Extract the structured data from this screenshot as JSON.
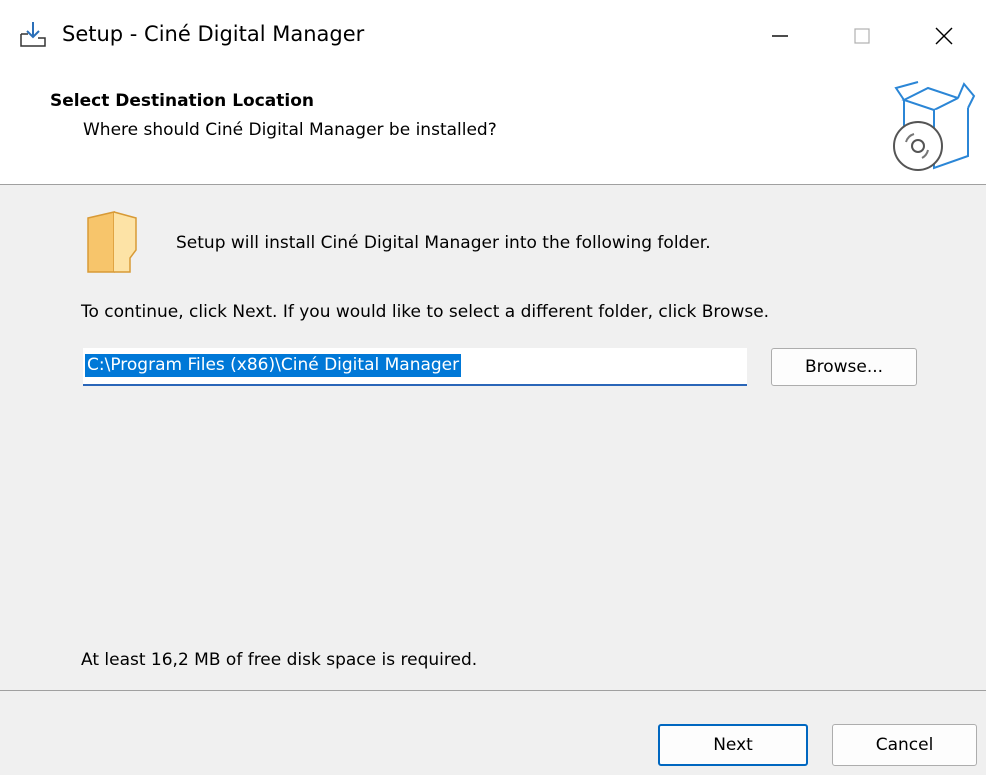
{
  "window": {
    "title": "Setup - Ciné Digital Manager",
    "icon": "installer-download-icon",
    "controls": {
      "minimize": "minimize-icon",
      "maximize": "maximize-icon",
      "close": "close-icon"
    }
  },
  "header": {
    "title": "Select Destination Location",
    "subtitle": "Where should Ciné Digital Manager be installed?",
    "icon": "software-box-disc-icon"
  },
  "main": {
    "intro": "Setup will install Ciné Digital Manager into the following folder.",
    "instruction": "To continue, click Next. If you would like to select a different folder, click Browse.",
    "path_value": "C:\\Program Files (x86)\\Ciné Digital Manager",
    "browse_label": "Browse...",
    "space_note": "At least 16,2 MB of free disk space is required."
  },
  "footer": {
    "next_label": "Next",
    "cancel_label": "Cancel"
  },
  "colors": {
    "selection": "#0078d7",
    "focus_border": "#0067c0",
    "folder": "#f7c56b",
    "box_outline": "#2b86d6"
  }
}
